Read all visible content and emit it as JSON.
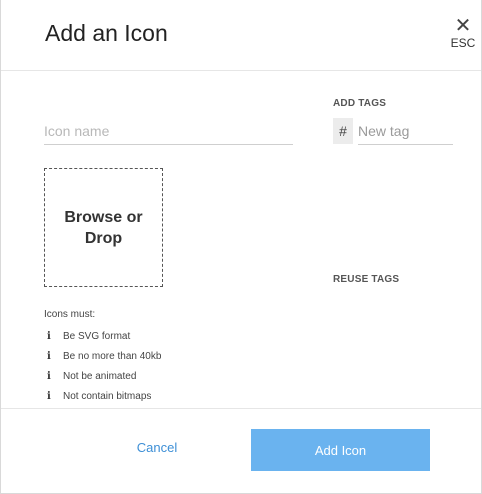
{
  "dialog": {
    "title": "Add an Icon",
    "close": {
      "icon": "close-icon",
      "glyph": "✕",
      "label": "ESC"
    }
  },
  "form": {
    "icon_name": {
      "value": "",
      "placeholder": "Icon name"
    },
    "add_tags": {
      "label": "ADD TAGS",
      "hash_symbol": "#",
      "value": "",
      "placeholder": "New tag"
    },
    "dropzone": {
      "label": "Browse or Drop"
    },
    "reuse_tags": {
      "label": "REUSE TAGS"
    }
  },
  "requirements": {
    "title": "Icons must:",
    "icon": "info-icon",
    "glyph": "i",
    "items": [
      "Be SVG format",
      "Be no more than 40kb",
      "Not be animated",
      "Not contain bitmaps"
    ]
  },
  "footer": {
    "cancel_label": "Cancel",
    "submit_label": "Add Icon"
  },
  "colors": {
    "accent": "#3d8fd6",
    "submit_bg": "#6ab3ef"
  }
}
